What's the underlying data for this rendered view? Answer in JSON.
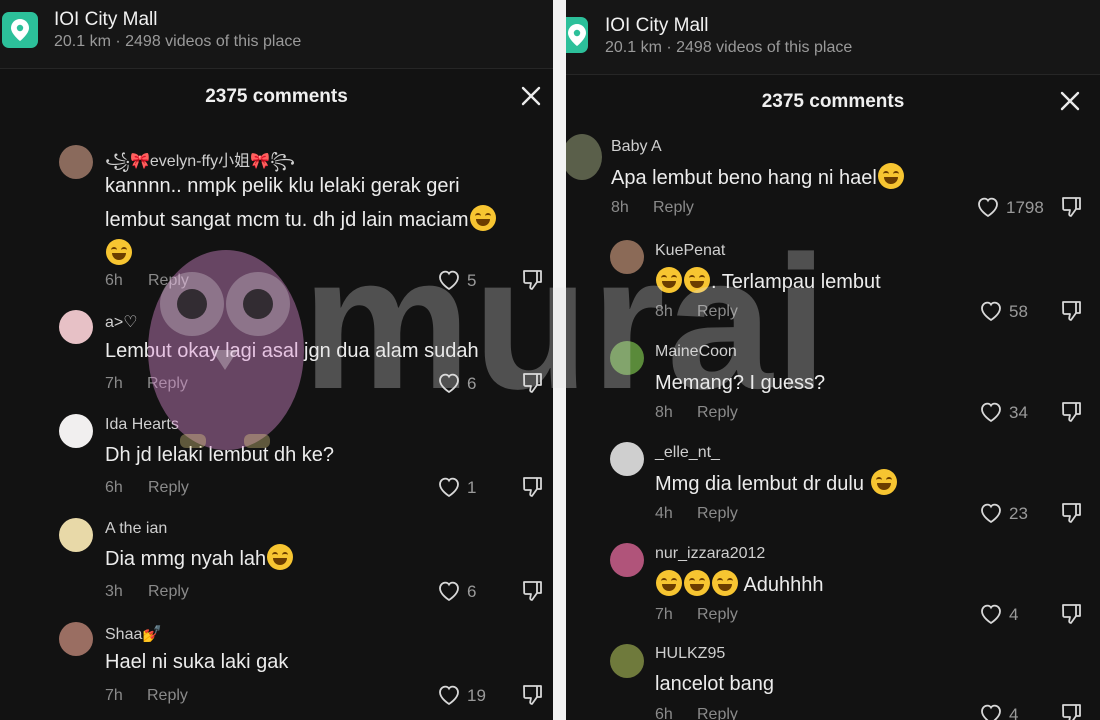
{
  "left": {
    "place": {
      "name": "IOI City Mall",
      "meta": "20.1 km · 2498 videos of this place"
    },
    "comments_title": "2375 comments",
    "comments": [
      {
        "username": "꧁🎀evelyn-ffy小姐🎀꧂",
        "text_line1": "kannnn.. nmpk pelik klu lelaki gerak geri",
        "text_line2": "lembut sangat mcm tu. dh jd lain maciam",
        "time": "6h",
        "reply": "Reply",
        "likes": "5"
      },
      {
        "username": "a>♡",
        "text": "Lembut okay lagi asal jgn dua alam sudah",
        "time": "7h",
        "reply": "Reply",
        "likes": "6"
      },
      {
        "username": "Ida Hearts",
        "text": "Dh jd lelaki lembut dh ke?",
        "time": "6h",
        "reply": "Reply",
        "likes": "1"
      },
      {
        "username": "A the ian",
        "text": "Dia mmg nyah lah",
        "time": "3h",
        "reply": "Reply",
        "likes": "6"
      },
      {
        "username": "Shaa💅",
        "text": "Hael ni suka laki gak",
        "time": "7h",
        "reply": "Reply",
        "likes": "19"
      }
    ]
  },
  "right": {
    "place": {
      "name": "IOI City Mall",
      "meta": "20.1 km · 2498 videos of this place"
    },
    "comments_title": "2375 comments",
    "comments": [
      {
        "username": "Baby A",
        "text": "Apa lembut beno hang ni hael",
        "time": "8h",
        "reply": "Reply",
        "likes": "1798"
      },
      {
        "username": "KuePenat",
        "text": ". Terlampau lembut",
        "time": "8h",
        "reply": "Reply",
        "likes": "58"
      },
      {
        "username": "MaineCoon",
        "text": "Memang? I guess?",
        "time": "8h",
        "reply": "Reply",
        "likes": "34"
      },
      {
        "username": "_elle_nt_",
        "text": "Mmg dia lembut dr dulu",
        "time": "4h",
        "reply": "Reply",
        "likes": "23"
      },
      {
        "username": "nur_izzara2012",
        "text": "Aduhhhh",
        "time": "7h",
        "reply": "Reply",
        "likes": "4"
      },
      {
        "username": "HULKZ95",
        "text": "lancelot bang",
        "time": "6h",
        "reply": "Reply",
        "likes": "4"
      }
    ]
  },
  "watermark": {
    "text": "murai"
  },
  "icons": {
    "place": "location-pin-icon",
    "close": "close-icon",
    "like": "heart-outline-icon",
    "dislike": "thumbs-down-icon",
    "emoji": "laughing-emoji-icon"
  },
  "colors": {
    "background": "#121212",
    "accent_place_icon": "#2cc09a",
    "watermark_owl": "#d98bd0"
  }
}
